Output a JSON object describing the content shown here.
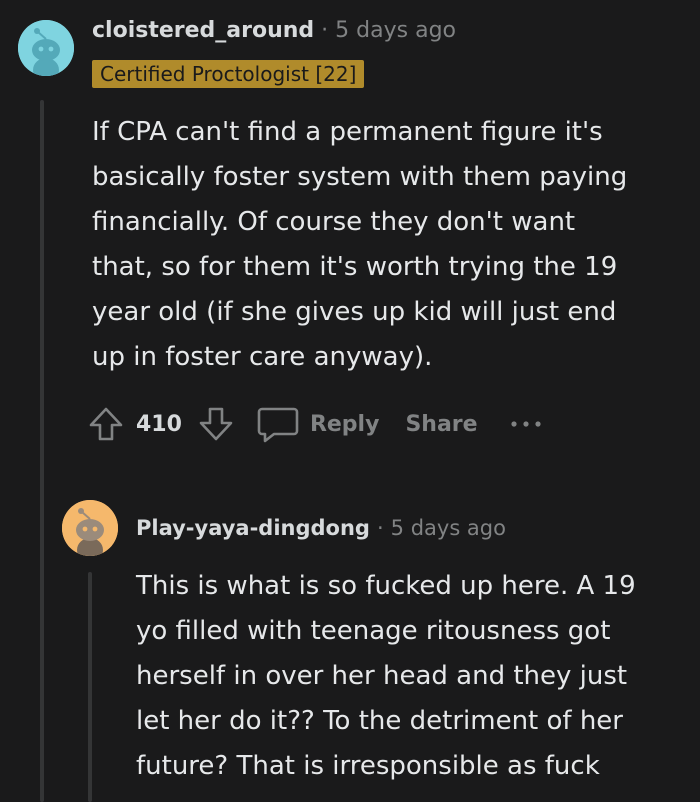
{
  "comments": [
    {
      "username": "cloistered_around",
      "separator": "·",
      "timestamp": "5 days ago",
      "flair": "Certified Proctologist [22]",
      "body": "If CPA can't find a permanent figure it's\nbasically foster system with them paying\nfinancially. Of course they don't want\nthat, so for them it's worth trying the 19\nyear old (if she gives up kid will just end\nup in foster care anyway).",
      "score": "410",
      "reply_label": "Reply",
      "share_label": "Share",
      "avatar_color": "#7fd4e0"
    },
    {
      "username": "Play-yaya-dingdong",
      "separator": "·",
      "timestamp": "5 days ago",
      "body": "This is what is so fucked up here. A 19\nyo filled with teenage ritousness got\nherself in over her head and they just\nlet her do it?? To the detriment of her\nfuture? That is irresponsible as fuck",
      "avatar_color": "#f5b86c"
    }
  ],
  "colors": {
    "background": "#1a1a1b",
    "flair_bg": "#b08b2b",
    "muted": "#818384",
    "text": "#e6e8ea"
  }
}
